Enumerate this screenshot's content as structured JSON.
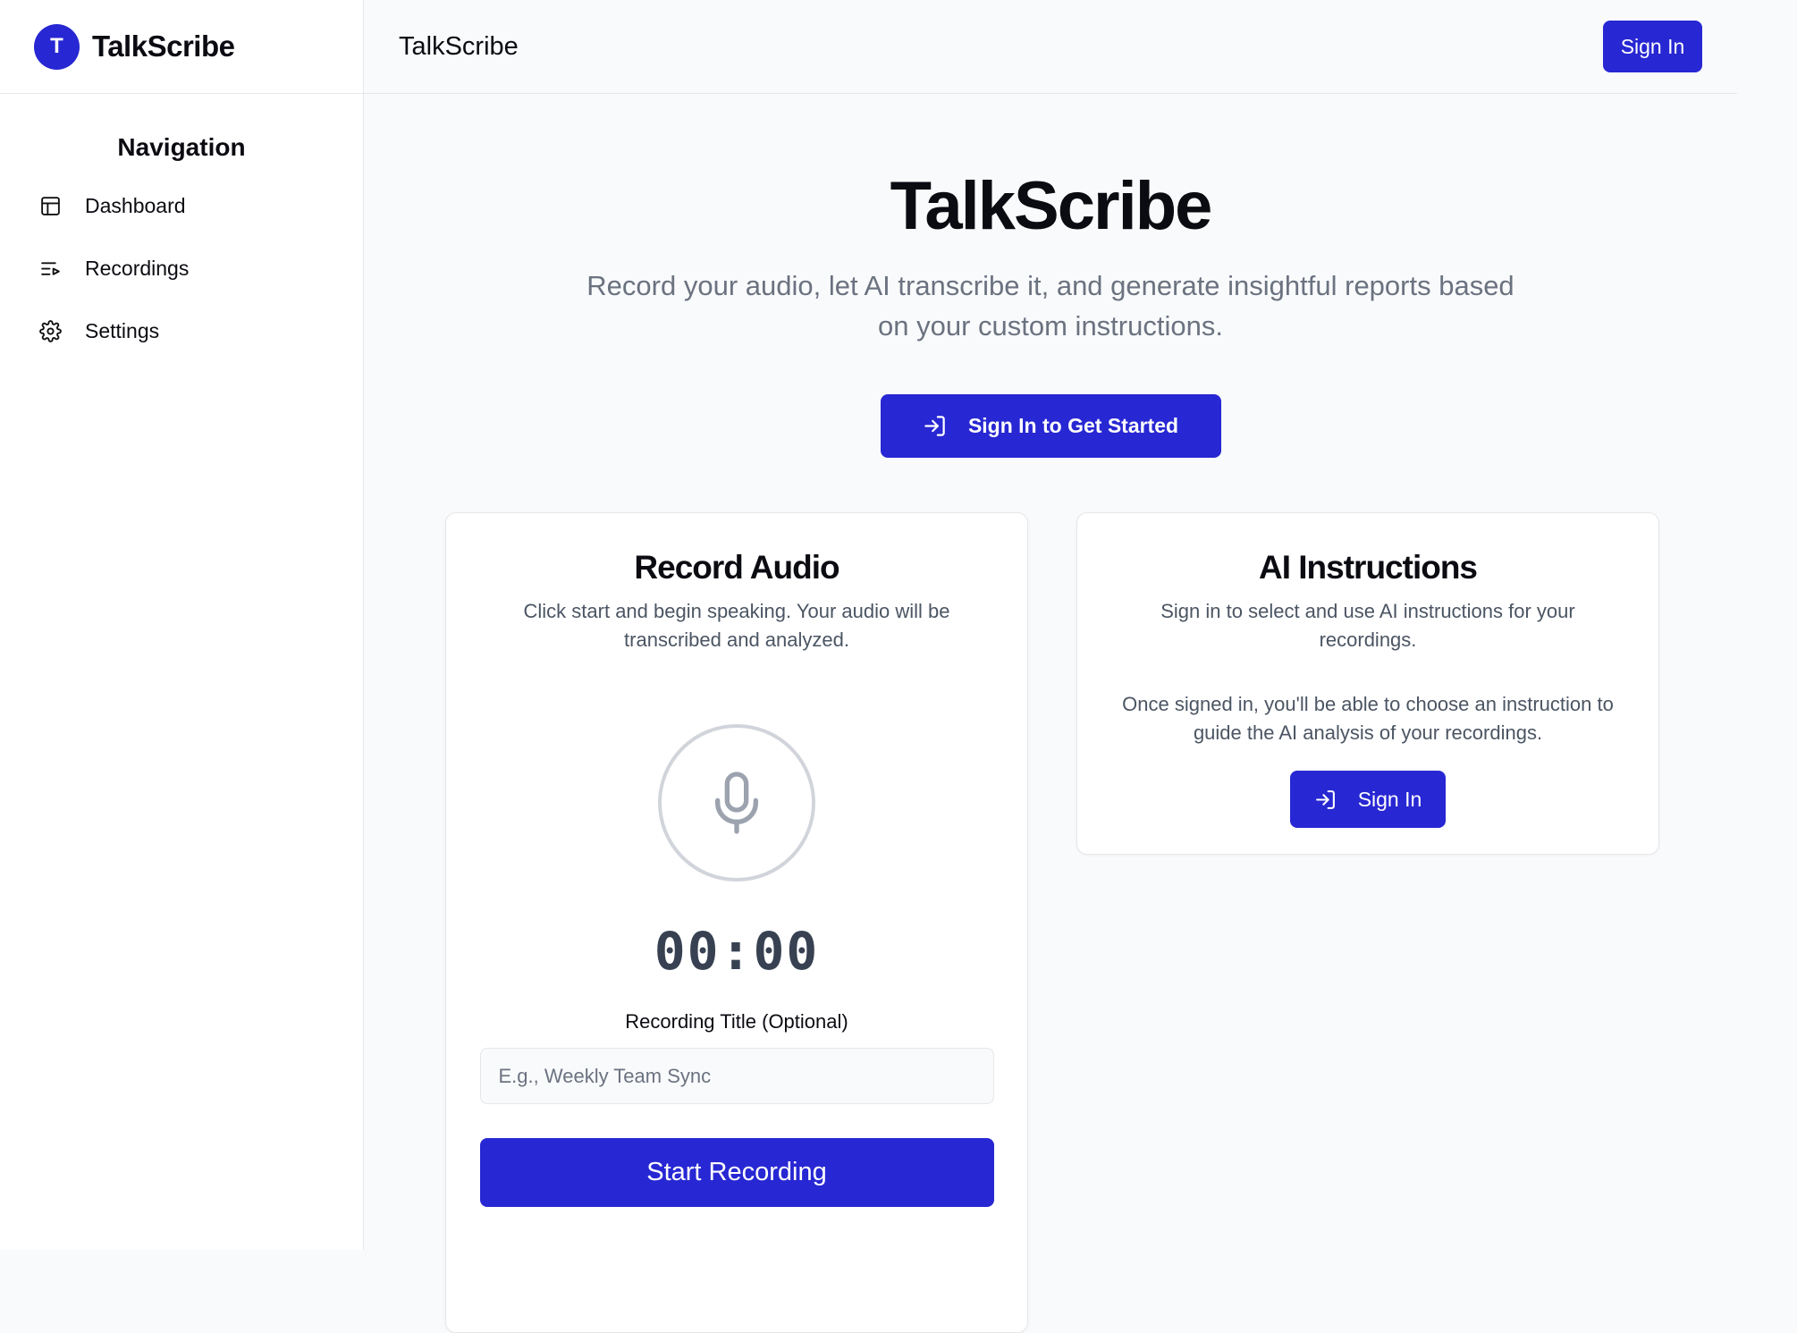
{
  "brand": {
    "avatar_letter": "T",
    "name": "TalkScribe"
  },
  "sidebar": {
    "title": "Navigation",
    "items": [
      {
        "label": "Dashboard",
        "icon": "layout-icon"
      },
      {
        "label": "Recordings",
        "icon": "list-play-icon"
      },
      {
        "label": "Settings",
        "icon": "gear-icon"
      }
    ]
  },
  "header": {
    "title": "TalkScribe",
    "sign_in_label": "Sign In"
  },
  "hero": {
    "title": "TalkScribe",
    "subtitle": "Record your audio, let AI transcribe it, and generate insightful reports based on your custom instructions.",
    "cta_label": "Sign In to Get Started"
  },
  "record_card": {
    "title": "Record Audio",
    "description": "Click start and begin speaking. Your audio will be transcribed and analyzed.",
    "timer": "00:00",
    "title_field_label": "Recording Title (Optional)",
    "title_field_placeholder": "E.g., Weekly Team Sync",
    "title_field_value": "",
    "start_label": "Start Recording"
  },
  "ai_card": {
    "title": "AI Instructions",
    "description": "Sign in to select and use AI instructions for your recordings.",
    "description2": "Once signed in, you'll be able to choose an instruction to guide the AI analysis of your recordings.",
    "sign_in_label": "Sign In"
  },
  "colors": {
    "accent": "#2727d3",
    "muted_text": "#6b7280",
    "border": "#e5e7eb"
  }
}
